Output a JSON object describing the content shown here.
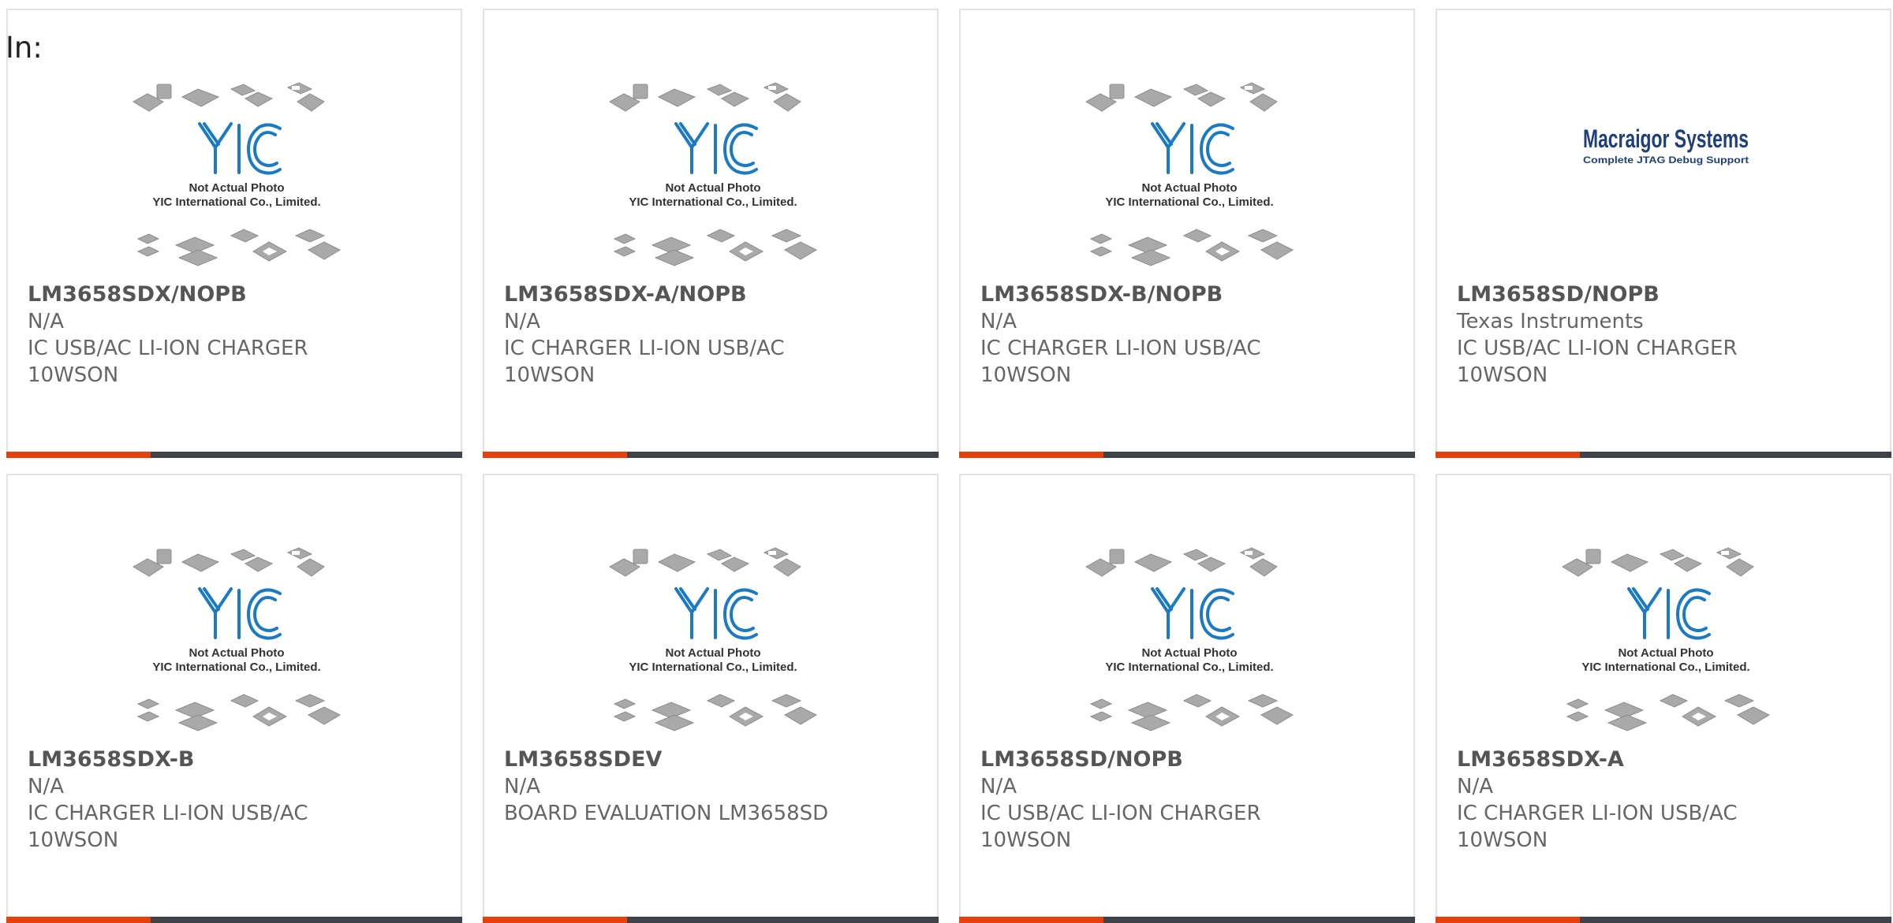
{
  "filter_label": "In:",
  "placeholder_caption": {
    "line1": "Not Actual Photo",
    "line2": "YIC International Co., Limited."
  },
  "logo_caption": {
    "line1": "Macraigor Systems",
    "line2": "Complete JTAG Debug Support"
  },
  "colors": {
    "accent": "#e8400c",
    "bar_dark": "#3f4347",
    "yic_blue": "#1a7bc4"
  },
  "products": [
    {
      "part": "LM3658SDX/NOPB",
      "manufacturer": "N/A",
      "description": "IC USB/AC LI-ION CHARGER",
      "package": "10WSON",
      "image": "yic-placeholder"
    },
    {
      "part": "LM3658SDX-A/NOPB",
      "manufacturer": "N/A",
      "description": "IC CHARGER LI-ION USB/AC",
      "package": "10WSON",
      "image": "yic-placeholder"
    },
    {
      "part": "LM3658SDX-B/NOPB",
      "manufacturer": "N/A",
      "description": "IC CHARGER LI-ION USB/AC",
      "package": "10WSON",
      "image": "yic-placeholder"
    },
    {
      "part": "LM3658SD/NOPB",
      "manufacturer": "Texas Instruments",
      "description": "IC USB/AC LI-ION CHARGER",
      "package": "10WSON",
      "image": "macraigor-logo"
    },
    {
      "part": "LM3658SDX-B",
      "manufacturer": "N/A",
      "description": "IC CHARGER LI-ION USB/AC",
      "package": "10WSON",
      "image": "yic-placeholder"
    },
    {
      "part": "LM3658SDEV",
      "manufacturer": "N/A",
      "description": "BOARD EVALUATION LM3658SD",
      "package": "",
      "image": "yic-placeholder"
    },
    {
      "part": "LM3658SD/NOPB",
      "manufacturer": "N/A",
      "description": "IC USB/AC LI-ION CHARGER",
      "package": "10WSON",
      "image": "yic-placeholder"
    },
    {
      "part": "LM3658SDX-A",
      "manufacturer": "N/A",
      "description": "IC CHARGER LI-ION USB/AC",
      "package": "10WSON",
      "image": "yic-placeholder"
    }
  ]
}
